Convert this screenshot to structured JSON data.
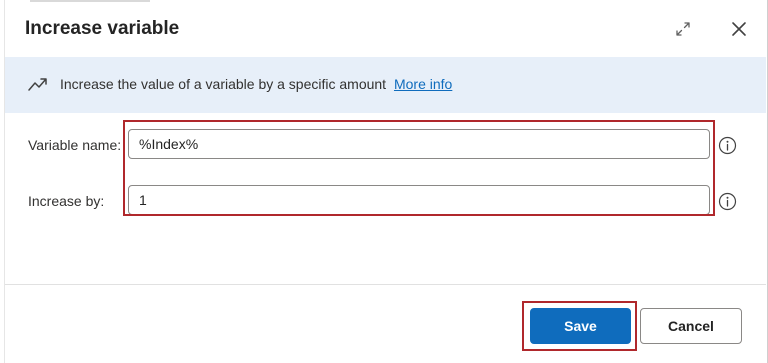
{
  "dialog": {
    "title": "Increase variable",
    "icons": {
      "expand": "expand-icon",
      "close": "close-icon"
    }
  },
  "banner": {
    "icon": "trending-up-icon",
    "text": "Increase the value of a variable by a specific amount",
    "link": "More info"
  },
  "form": {
    "variable_name": {
      "label": "Variable name:",
      "value": "%Index%",
      "info_icon": "info-icon"
    },
    "increase_by": {
      "label": "Increase by:",
      "value": "1",
      "info_icon": "info-icon"
    }
  },
  "footer": {
    "save_label": "Save",
    "cancel_label": "Cancel"
  },
  "colors": {
    "accent": "#0f6cbd",
    "banner_bg": "#e7eff9",
    "highlight": "#b0282c"
  }
}
